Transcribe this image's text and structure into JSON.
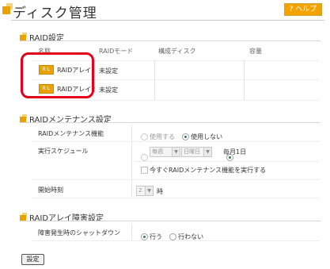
{
  "header": {
    "title": "ディスク管理",
    "help_label": "? ヘルプ"
  },
  "raid_settings": {
    "section_title": "RAID設定",
    "columns": {
      "name": "名称",
      "mode": "RAIDモード",
      "disk": "構成ディスク",
      "capacity": "容量"
    },
    "rows": [
      {
        "badge": "ＲＬ",
        "name": "RAIDアレイ1",
        "mode": "未設定",
        "disk": "",
        "capacity": ""
      },
      {
        "badge": "ＲＬ",
        "name": "RAIDアレイ2",
        "mode": "未設定",
        "disk": "",
        "capacity": ""
      }
    ]
  },
  "maintenance": {
    "section_title": "RAIDメンテナンス設定",
    "function_label": "RAIDメンテナンス機能",
    "use_label": "使用する",
    "nouse_label": "使用しない",
    "schedule_label": "実行スケジュール",
    "week_select": "毎週",
    "day_select": "日曜日",
    "monthly_label": "毎月1日",
    "run_now_label": "今すぐRAIDメンテナンス機能を実行する",
    "start_label": "開始時刻",
    "hour_value": "2",
    "hour_unit": "時"
  },
  "failure": {
    "section_title": "RAIDアレイ障害設定",
    "shutdown_label": "障害発生時のシャットダウン",
    "do_label": "行う",
    "dont_label": "行わない"
  },
  "footer": {
    "settings_label": "設定"
  }
}
